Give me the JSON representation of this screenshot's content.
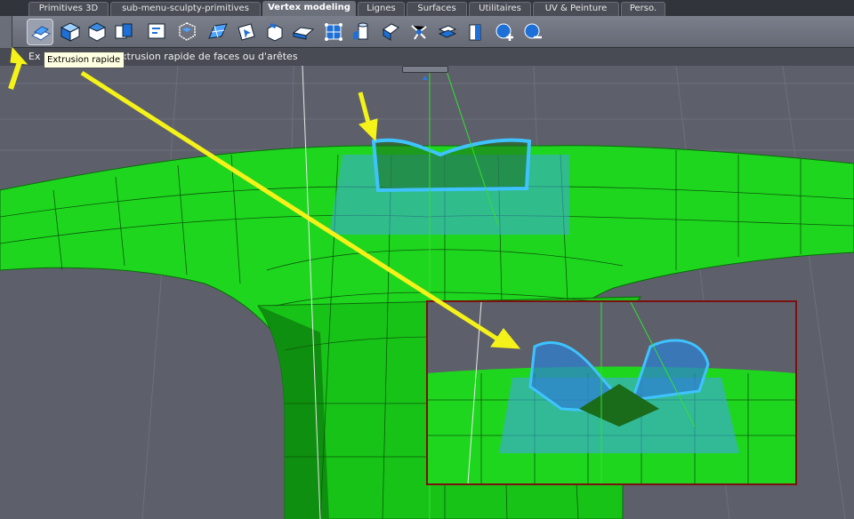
{
  "tabs": [
    {
      "label": "Primitives 3D",
      "active": false
    },
    {
      "label": "sub-menu-sculpty-primitives",
      "active": false
    },
    {
      "label": "Vertex modeling",
      "active": true
    },
    {
      "label": "Lignes",
      "active": false
    },
    {
      "label": "Surfaces",
      "active": false
    },
    {
      "label": "Utilitaires",
      "active": false
    },
    {
      "label": "UV & Peinture",
      "active": false
    },
    {
      "label": "Perso.",
      "active": false
    }
  ],
  "toolbar": {
    "tools": [
      "extrusion-rapide-icon",
      "cube-icon",
      "bevel-cube-icon",
      "split-cube-icon",
      "quad-icon",
      "box-select-icon",
      "mesh-fold-icon",
      "cursor-mesh-icon",
      "box-open-icon",
      "strip-icon",
      "vertex-grid-icon",
      "cylinder-icon",
      "face-turn-icon",
      "node-tree-icon",
      "layers-icon",
      "cylinder-cut-icon",
      "add-sphere-icon",
      "remove-sphere-icon"
    ]
  },
  "status": {
    "prefix": "Ex",
    "text": "xtrusion rapide de faces ou d'arêtes"
  },
  "tooltip": {
    "text": "Extrusion rapide"
  },
  "colors": {
    "mesh_green": "#1fd61f",
    "mesh_dark": "#0b8a0b",
    "selection_blue": "#3fa7e6",
    "arrow_yellow": "#f5f21a",
    "inset_border": "#7a1010"
  }
}
